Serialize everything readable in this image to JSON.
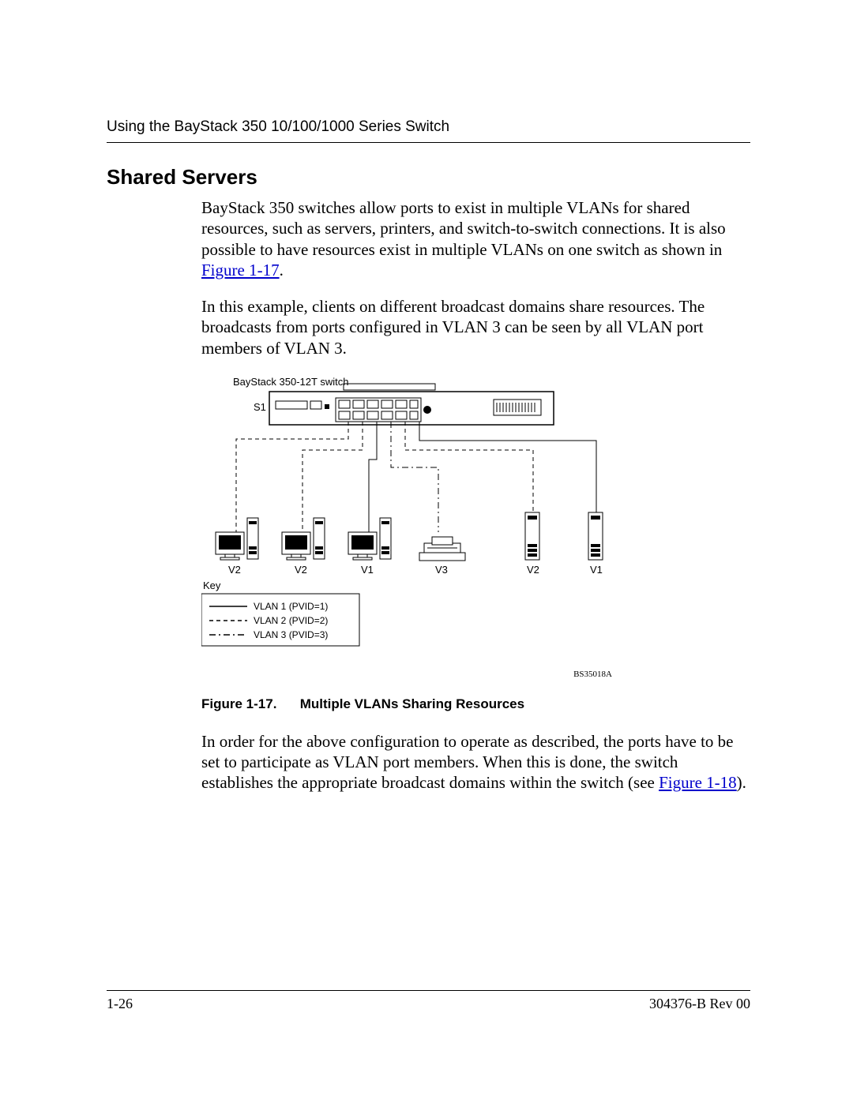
{
  "header": {
    "running_head": "Using the BayStack 350 10/100/1000 Series Switch"
  },
  "section": {
    "title": "Shared Servers",
    "para1_a": "BayStack 350 switches allow ports to exist in multiple VLANs for shared resources, such as servers, printers, and switch-to-switch connections. It is also possible to have resources exist in multiple VLANs on one switch as shown in ",
    "para1_link": "Figure 1-17",
    "para1_b": ".",
    "para2": "In this example, clients on different broadcast domains share resources. The broadcasts from ports configured in VLAN 3 can be seen by all VLAN port members of VLAN 3.",
    "para3_a": "In order for the above configuration to operate as described, the ports have to be set to participate as VLAN port members. When this is done, the switch establishes the appropriate broadcast domains within the switch (see ",
    "para3_link": "Figure 1-18",
    "para3_b": ")."
  },
  "figure": {
    "switch_label": "BayStack 350-12T switch",
    "s1": "S1",
    "dev_labels": [
      "V2",
      "V2",
      "V1",
      "V3",
      "V2",
      "V1"
    ],
    "key_title": "Key",
    "key_rows": [
      "VLAN 1 (PVID=1)",
      "VLAN 2 (PVID=2)",
      "VLAN 3 (PVID=3)"
    ],
    "id": "BS35018A",
    "caption_num": "Figure 1-17.",
    "caption_title": "Multiple VLANs Sharing Resources"
  },
  "footer": {
    "page": "1-26",
    "doc": "304376-B Rev 00"
  }
}
